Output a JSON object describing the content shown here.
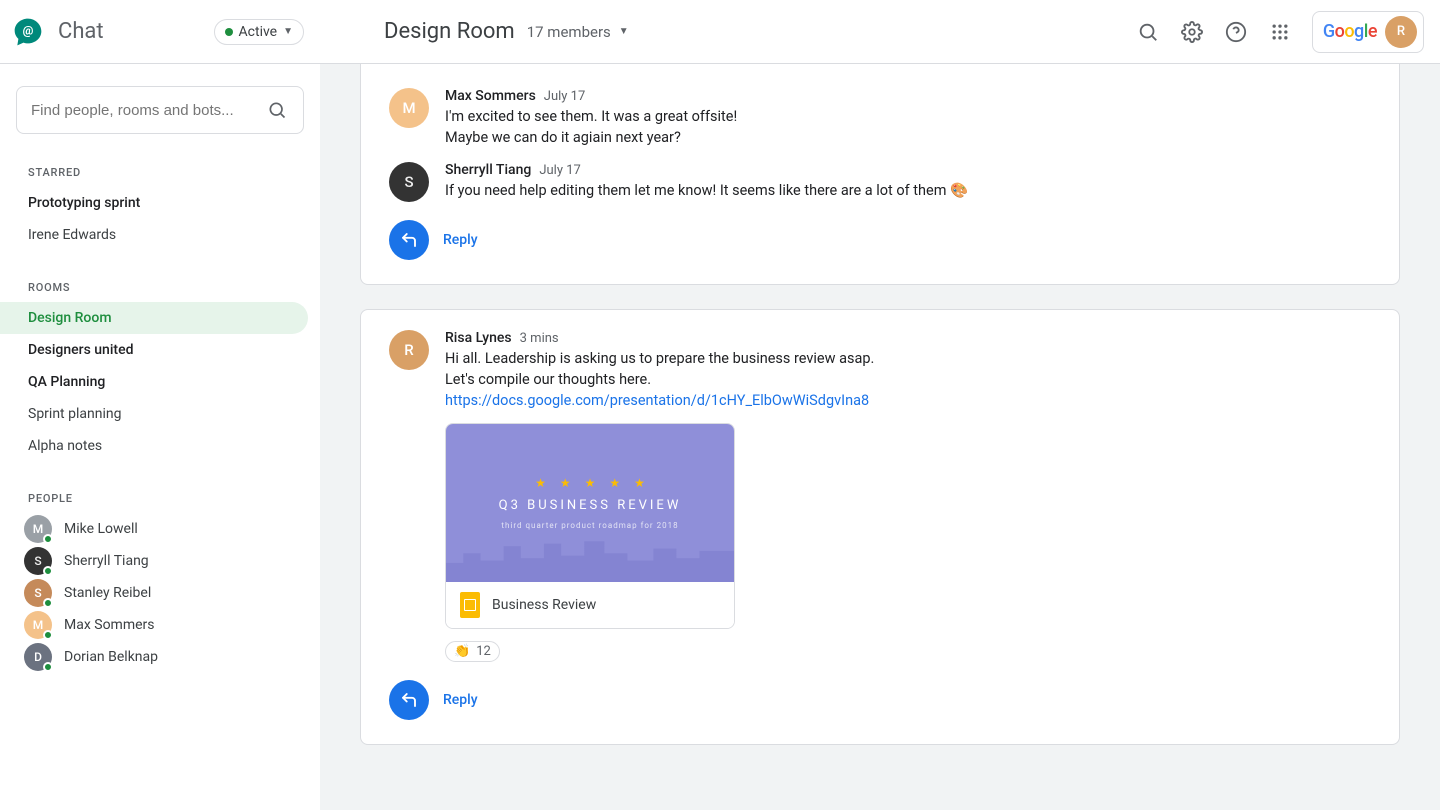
{
  "header": {
    "app_name": "Chat",
    "status_label": "Active",
    "room_title": "Design Room",
    "members_label": "17 members",
    "search_placeholder": "Find people, rooms and bots...",
    "google_logo": "Google"
  },
  "sidebar": {
    "sections": {
      "starred_label": "STARRED",
      "rooms_label": "ROOMS",
      "people_label": "PEOPLE"
    },
    "starred": [
      {
        "label": "Prototyping sprint",
        "bold": true
      },
      {
        "label": "Irene Edwards",
        "bold": false
      }
    ],
    "rooms": [
      {
        "label": "Design Room",
        "active": true,
        "bold": true
      },
      {
        "label": "Designers united",
        "bold": true
      },
      {
        "label": "QA Planning",
        "bold": true
      },
      {
        "label": "Sprint planning",
        "bold": false
      },
      {
        "label": "Alpha notes",
        "bold": false
      }
    ],
    "people": [
      {
        "label": "Mike Lowell",
        "initials": "M",
        "cls": "av-mike"
      },
      {
        "label": "Sherryll Tiang",
        "initials": "S",
        "cls": "av-sherryl"
      },
      {
        "label": "Stanley Reibel",
        "initials": "S",
        "cls": "av-stanley"
      },
      {
        "label": "Max Sommers",
        "initials": "M",
        "cls": "av-max"
      },
      {
        "label": "Dorian Belknap",
        "initials": "D",
        "cls": "av-dorian"
      }
    ]
  },
  "threads": [
    {
      "messages": [
        {
          "author": "Max Sommers",
          "time": "July 17",
          "initials": "M",
          "avatar_cls": "av-max",
          "lines": [
            "I'm excited to see them. It was a great offsite!",
            "Maybe we can do it agiain next year?"
          ]
        },
        {
          "author": "Sherryll Tiang",
          "time": "July 17",
          "initials": "S",
          "avatar_cls": "av-sherryl",
          "lines": [
            "If you need help editing them let me know! It seems like there are a lot of them 🎨"
          ]
        }
      ],
      "reply_label": "Reply"
    },
    {
      "messages": [
        {
          "author": "Risa Lynes",
          "time": "3 mins",
          "initials": "R",
          "avatar_cls": "av-risa",
          "lines": [
            "Hi all. Leadership is asking us to prepare the business review asap.",
            "Let's compile our thoughts here."
          ],
          "link": "https://docs.google.com/presentation/d/1cHY_ElbOwWiSdgvIna8",
          "attachment": {
            "preview_title": "Q3 BUSINESS REVIEW",
            "preview_sub": "third quarter product roadmap for 2018",
            "file_name": "Business Review"
          },
          "reaction": {
            "emoji": "👏",
            "count": "12"
          }
        }
      ],
      "reply_label": "Reply"
    }
  ]
}
